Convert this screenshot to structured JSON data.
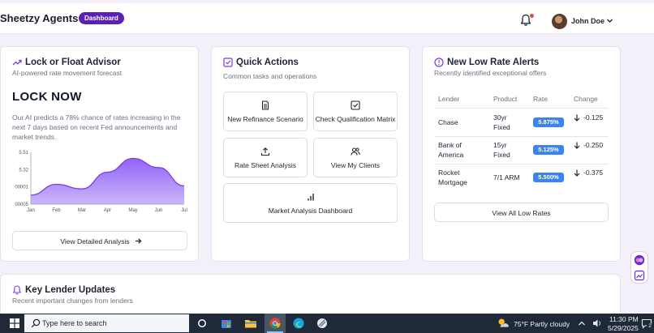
{
  "header": {
    "brand": "Sheetzy Agents",
    "badge": "Dashboard",
    "user_name": "John Doe"
  },
  "advisor": {
    "title": "Lock or Float Advisor",
    "subtitle": "AI-powered rate movement forecast",
    "recommendation": "LOCK NOW",
    "prediction": "Our AI predicts a 78% chance of rates increasing in the next 7 days based on recent Fed announcements and market trends.",
    "button_label": "View Detailed Analysis"
  },
  "chart_data": {
    "type": "area",
    "categories": [
      "Jan",
      "Feb",
      "Mar",
      "Apr",
      "May",
      "Jun",
      "Jul"
    ],
    "y_tick_labels": [
      "5.51",
      "5.32",
      "00001",
      "00005"
    ],
    "series": [
      {
        "values": [
          5.23,
          5.3,
          5.27,
          5.38,
          5.47,
          5.41,
          5.29
        ]
      }
    ],
    "ylim": [
      5.17,
      5.51
    ],
    "fill_color": "#8b5cf6",
    "grid": false
  },
  "quick_actions": {
    "title": "Quick Actions",
    "subtitle": "Common tasks and operations",
    "tiles": [
      {
        "label": "New Refinance Scenario",
        "icon": "document-icon"
      },
      {
        "label": "Check Qualification Matrix",
        "icon": "checkbox-icon"
      },
      {
        "label": "Rate Sheet Analysis",
        "icon": "upload-icon"
      },
      {
        "label": "View My Clients",
        "icon": "users-icon"
      },
      {
        "label": "Market Analysis Dashboard",
        "icon": "bar-chart-icon"
      }
    ]
  },
  "alerts": {
    "title": "New Low Rate Alerts",
    "subtitle": "Recently identified exceptional offers",
    "columns": [
      "Lender",
      "Product",
      "Rate",
      "Change"
    ],
    "rows": [
      {
        "lender": [
          "Chase"
        ],
        "product": [
          "30yr",
          "Fixed"
        ],
        "rate": "5.875%",
        "change": "-0.125"
      },
      {
        "lender": [
          "Bank of",
          "America"
        ],
        "product": [
          "15yr",
          "Fixed"
        ],
        "rate": "5.125%",
        "change": "-0.250"
      },
      {
        "lender": [
          "Rocket",
          "Mortgage"
        ],
        "product": [
          "7/1 ARM"
        ],
        "rate": "5.500%",
        "change": "-0.375"
      }
    ],
    "button_label": "View All Low Rates"
  },
  "lender_updates": {
    "title": "Key Lender Updates",
    "subtitle": "Recent important changes from lenders"
  },
  "taskbar": {
    "search_placeholder": "Type here to search",
    "weather": "75°F  Partly cloudy",
    "time": "11:30 PM",
    "date": "5/29/2025",
    "notification_count": "2"
  },
  "colors": {
    "accent": "#5b21b6",
    "rate_pill": "#3b82f6",
    "background": "#f3f0fa"
  }
}
